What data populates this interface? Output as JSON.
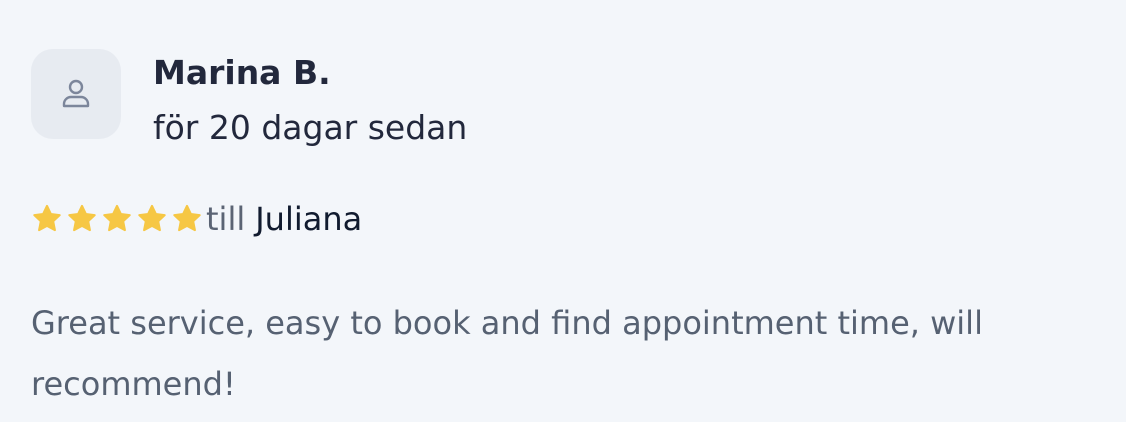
{
  "reviewer": {
    "name": "Marina B.",
    "date": "för 20 dagar sedan",
    "avatar_icon": "user-icon"
  },
  "rating": {
    "stars": 5,
    "max": 5,
    "star_color": "#f6c744",
    "star_icon": "star-icon",
    "prefix": "till",
    "staff_name": "Juliana"
  },
  "review": {
    "text": "Great service, easy to book and find appointment time, will recommend!"
  },
  "colors": {
    "background": "#f3f6fa",
    "avatar_bg": "#e7ebf1",
    "text_dark": "#22283c",
    "text_muted": "#566172"
  }
}
